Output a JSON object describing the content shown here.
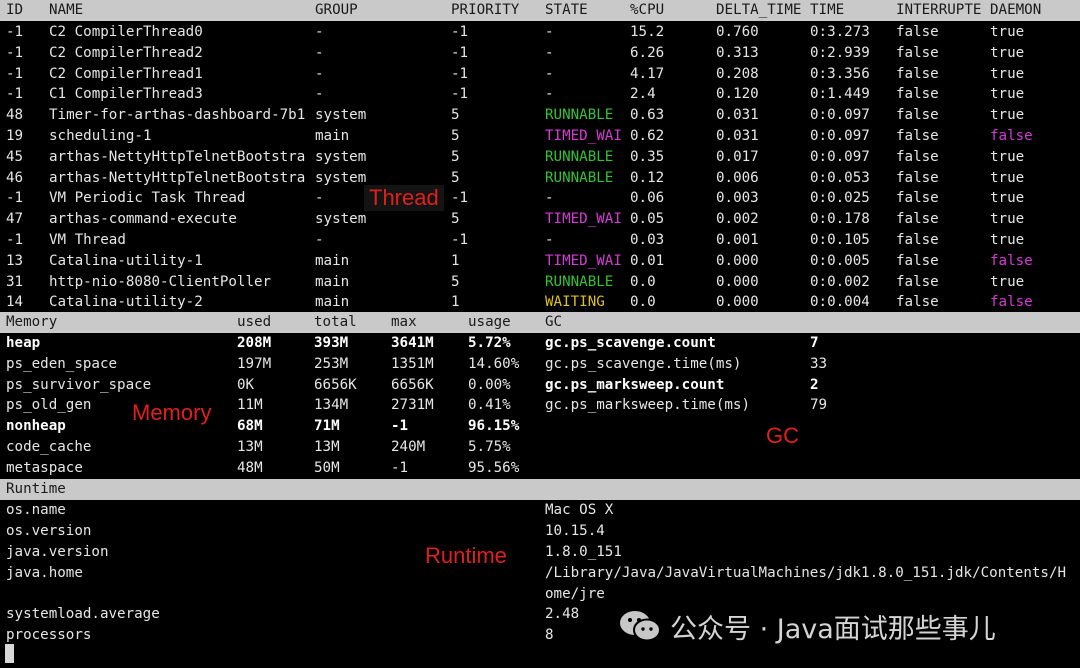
{
  "thread": {
    "columns": [
      "ID",
      "NAME",
      "GROUP",
      "PRIORITY",
      "STATE",
      "%CPU",
      "DELTA_TIME",
      "TIME",
      "INTERRUPTE",
      "DAEMON"
    ],
    "rows": [
      {
        "id": "-1",
        "name": "C2 CompilerThread0",
        "group": "-",
        "priority": "-1",
        "state": "-",
        "state_color": "#e6e6e6",
        "cpu": "15.2",
        "delta": "0.760",
        "time": "0:3.273",
        "interrupted": "false",
        "daemon": "true",
        "daemon_color": "#e6e6e6"
      },
      {
        "id": "-1",
        "name": "C2 CompilerThread2",
        "group": "-",
        "priority": "-1",
        "state": "-",
        "state_color": "#e6e6e6",
        "cpu": "6.26",
        "delta": "0.313",
        "time": "0:2.939",
        "interrupted": "false",
        "daemon": "true",
        "daemon_color": "#e6e6e6"
      },
      {
        "id": "-1",
        "name": "C2 CompilerThread1",
        "group": "-",
        "priority": "-1",
        "state": "-",
        "state_color": "#e6e6e6",
        "cpu": "4.17",
        "delta": "0.208",
        "time": "0:3.356",
        "interrupted": "false",
        "daemon": "true",
        "daemon_color": "#e6e6e6"
      },
      {
        "id": "-1",
        "name": "C1 CompilerThread3",
        "group": "-",
        "priority": "-1",
        "state": "-",
        "state_color": "#e6e6e6",
        "cpu": "2.4",
        "delta": "0.120",
        "time": "0:1.449",
        "interrupted": "false",
        "daemon": "true",
        "daemon_color": "#e6e6e6"
      },
      {
        "id": "48",
        "name": "Timer-for-arthas-dashboard-7b1",
        "group": "system",
        "priority": "5",
        "state": "RUNNABLE",
        "state_color": "#33c233",
        "cpu": "0.63",
        "delta": "0.031",
        "time": "0:0.097",
        "interrupted": "false",
        "daemon": "true",
        "daemon_color": "#e6e6e6"
      },
      {
        "id": "19",
        "name": "scheduling-1",
        "group": "main",
        "priority": "5",
        "state": "TIMED_WAI",
        "state_color": "#d63ad6",
        "cpu": "0.62",
        "delta": "0.031",
        "time": "0:0.097",
        "interrupted": "false",
        "daemon": "false",
        "daemon_color": "#d63ad6"
      },
      {
        "id": "45",
        "name": "arthas-NettyHttpTelnetBootstra",
        "group": "system",
        "priority": "5",
        "state": "RUNNABLE",
        "state_color": "#33c233",
        "cpu": "0.35",
        "delta": "0.017",
        "time": "0:0.097",
        "interrupted": "false",
        "daemon": "true",
        "daemon_color": "#e6e6e6"
      },
      {
        "id": "46",
        "name": "arthas-NettyHttpTelnetBootstra",
        "group": "system",
        "priority": "5",
        "state": "RUNNABLE",
        "state_color": "#33c233",
        "cpu": "0.12",
        "delta": "0.006",
        "time": "0:0.053",
        "interrupted": "false",
        "daemon": "true",
        "daemon_color": "#e6e6e6"
      },
      {
        "id": "-1",
        "name": "VM Periodic Task Thread",
        "group": "-",
        "priority": "-1",
        "state": "-",
        "state_color": "#e6e6e6",
        "cpu": "0.06",
        "delta": "0.003",
        "time": "0:0.025",
        "interrupted": "false",
        "daemon": "true",
        "daemon_color": "#e6e6e6"
      },
      {
        "id": "47",
        "name": "arthas-command-execute",
        "group": "system",
        "priority": "5",
        "state": "TIMED_WAI",
        "state_color": "#d63ad6",
        "cpu": "0.05",
        "delta": "0.002",
        "time": "0:0.178",
        "interrupted": "false",
        "daemon": "true",
        "daemon_color": "#e6e6e6"
      },
      {
        "id": "-1",
        "name": "VM Thread",
        "group": "-",
        "priority": "-1",
        "state": "-",
        "state_color": "#e6e6e6",
        "cpu": "0.03",
        "delta": "0.001",
        "time": "0:0.105",
        "interrupted": "false",
        "daemon": "true",
        "daemon_color": "#e6e6e6"
      },
      {
        "id": "13",
        "name": "Catalina-utility-1",
        "group": "main",
        "priority": "1",
        "state": "TIMED_WAI",
        "state_color": "#d63ad6",
        "cpu": "0.01",
        "delta": "0.000",
        "time": "0:0.005",
        "interrupted": "false",
        "daemon": "false",
        "daemon_color": "#d63ad6"
      },
      {
        "id": "31",
        "name": "http-nio-8080-ClientPoller",
        "group": "main",
        "priority": "5",
        "state": "RUNNABLE",
        "state_color": "#33c233",
        "cpu": "0.0",
        "delta": "0.000",
        "time": "0:0.002",
        "interrupted": "false",
        "daemon": "true",
        "daemon_color": "#e6e6e6"
      },
      {
        "id": "14",
        "name": "Catalina-utility-2",
        "group": "main",
        "priority": "1",
        "state": "WAITING",
        "state_color": "#e0c21a",
        "cpu": "0.0",
        "delta": "0.000",
        "time": "0:0.004",
        "interrupted": "false",
        "daemon": "false",
        "daemon_color": "#d63ad6"
      }
    ]
  },
  "memory": {
    "columns": [
      "Memory",
      "used",
      "total",
      "max",
      "usage"
    ],
    "rows": [
      {
        "name": "heap",
        "used": "208M",
        "total": "393M",
        "max": "3641M",
        "usage": "5.72%",
        "bold": true
      },
      {
        "name": "ps_eden_space",
        "used": "197M",
        "total": "253M",
        "max": "1351M",
        "usage": "14.60%",
        "bold": false
      },
      {
        "name": "ps_survivor_space",
        "used": "0K",
        "total": "6656K",
        "max": "6656K",
        "usage": "0.00%",
        "bold": false
      },
      {
        "name": "ps_old_gen",
        "used": "11M",
        "total": "134M",
        "max": "2731M",
        "usage": "0.41%",
        "bold": false
      },
      {
        "name": "nonheap",
        "used": "68M",
        "total": "71M",
        "max": "-1",
        "usage": "96.15%",
        "bold": true
      },
      {
        "name": "code_cache",
        "used": "13M",
        "total": "13M",
        "max": "240M",
        "usage": "5.75%",
        "bold": false
      },
      {
        "name": "metaspace",
        "used": "48M",
        "total": "50M",
        "max": "-1",
        "usage": "95.56%",
        "bold": false
      }
    ]
  },
  "gc": {
    "header": "GC",
    "rows": [
      {
        "name": "gc.ps_scavenge.count",
        "value": "7",
        "bold": true
      },
      {
        "name": "gc.ps_scavenge.time(ms)",
        "value": "33",
        "bold": false
      },
      {
        "name": "gc.ps_marksweep.count",
        "value": "2",
        "bold": true
      },
      {
        "name": "gc.ps_marksweep.time(ms)",
        "value": "79",
        "bold": false
      }
    ]
  },
  "runtime": {
    "header": "Runtime",
    "os_name_label": "os.name",
    "os_name_value": "Mac OS X",
    "os_version_label": "os.version",
    "os_version_value": "10.15.4",
    "java_version_label": "java.version",
    "java_version_value": "1.8.0_151",
    "java_home_label": "java.home",
    "java_home_value_line1": "/Library/Java/JavaVirtualMachines/jdk1.8.0_151.jdk/Contents/H",
    "java_home_value_line2": "ome/jre",
    "systemload_label": "systemload.average",
    "systemload_value": "2.48",
    "processors_label": "processors",
    "processors_value": "8"
  },
  "annotations": {
    "thread": "Thread",
    "memory": "Memory",
    "gc": "GC",
    "runtime": "Runtime",
    "color": "#e0201c"
  },
  "watermark": {
    "text": "公众号 · Java面试那些事儿",
    "icon": "wechat-icon"
  }
}
